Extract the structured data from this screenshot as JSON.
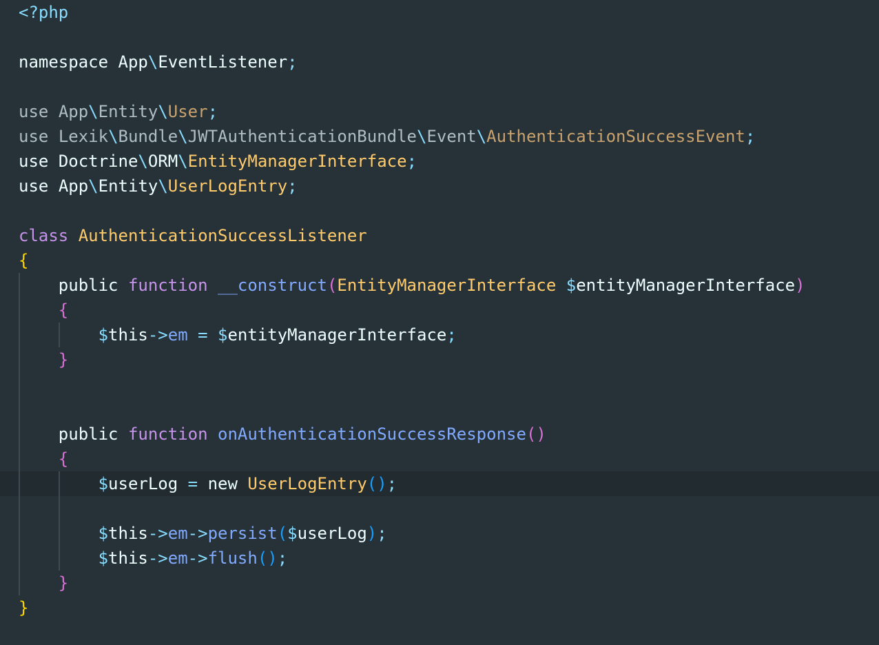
{
  "editor": {
    "language": "php",
    "theme_colors": {
      "background": "#263238",
      "current_line": "#222b30",
      "keyword": "#c792ea",
      "class_name": "#ffcb6b",
      "function": "#82aaff",
      "punctuation": "#89ddff",
      "brace_level_1": "#ffd700",
      "brace_level_2": "#da70d6",
      "brace_level_3": "#179fff"
    },
    "current_line_index": 19,
    "lines": [
      [
        {
          "t": "<?php",
          "c": "tag"
        }
      ],
      [],
      [
        {
          "t": "namespace",
          "c": "plain"
        },
        {
          "t": " ",
          "c": "plain"
        },
        {
          "t": "App",
          "c": "plain"
        },
        {
          "t": "\\",
          "c": "sep"
        },
        {
          "t": "EventListener",
          "c": "plain"
        },
        {
          "t": ";",
          "c": "punc"
        }
      ],
      [],
      [
        {
          "t": "use",
          "c": "ns"
        },
        {
          "t": " ",
          "c": "plain"
        },
        {
          "t": "App",
          "c": "ns"
        },
        {
          "t": "\\",
          "c": "sep"
        },
        {
          "t": "Entity",
          "c": "ns"
        },
        {
          "t": "\\",
          "c": "sep"
        },
        {
          "t": "User",
          "c": "clsd"
        },
        {
          "t": ";",
          "c": "punc"
        }
      ],
      [
        {
          "t": "use",
          "c": "ns"
        },
        {
          "t": " ",
          "c": "plain"
        },
        {
          "t": "Lexik",
          "c": "ns"
        },
        {
          "t": "\\",
          "c": "sep"
        },
        {
          "t": "Bundle",
          "c": "ns"
        },
        {
          "t": "\\",
          "c": "sep"
        },
        {
          "t": "JWTAuthenticationBundle",
          "c": "ns"
        },
        {
          "t": "\\",
          "c": "sep"
        },
        {
          "t": "Event",
          "c": "ns"
        },
        {
          "t": "\\",
          "c": "sep"
        },
        {
          "t": "AuthenticationSuccessEvent",
          "c": "clsd"
        },
        {
          "t": ";",
          "c": "punc"
        }
      ],
      [
        {
          "t": "use",
          "c": "plain"
        },
        {
          "t": " ",
          "c": "plain"
        },
        {
          "t": "Doctrine",
          "c": "plain"
        },
        {
          "t": "\\",
          "c": "sep"
        },
        {
          "t": "ORM",
          "c": "plain"
        },
        {
          "t": "\\",
          "c": "sep"
        },
        {
          "t": "EntityManagerInterface",
          "c": "cls"
        },
        {
          "t": ";",
          "c": "punc"
        }
      ],
      [
        {
          "t": "use",
          "c": "plain"
        },
        {
          "t": " ",
          "c": "plain"
        },
        {
          "t": "App",
          "c": "plain"
        },
        {
          "t": "\\",
          "c": "sep"
        },
        {
          "t": "Entity",
          "c": "plain"
        },
        {
          "t": "\\",
          "c": "sep"
        },
        {
          "t": "UserLogEntry",
          "c": "cls"
        },
        {
          "t": ";",
          "c": "punc"
        }
      ],
      [],
      [
        {
          "t": "class",
          "c": "kw"
        },
        {
          "t": " ",
          "c": "plain"
        },
        {
          "t": "AuthenticationSuccessListener",
          "c": "cls"
        }
      ],
      [
        {
          "t": "{",
          "c": "brace1"
        }
      ],
      [
        {
          "t": "    ",
          "c": "plain"
        },
        {
          "t": "public",
          "c": "plain"
        },
        {
          "t": " ",
          "c": "plain"
        },
        {
          "t": "function",
          "c": "kw"
        },
        {
          "t": " ",
          "c": "plain"
        },
        {
          "t": "__construct",
          "c": "fn"
        },
        {
          "t": "(",
          "c": "brace2"
        },
        {
          "t": "EntityManagerInterface",
          "c": "cls"
        },
        {
          "t": " ",
          "c": "plain"
        },
        {
          "t": "$",
          "c": "dollar"
        },
        {
          "t": "entityManagerInterface",
          "c": "var"
        },
        {
          "t": ")",
          "c": "brace2"
        }
      ],
      [
        {
          "t": "    ",
          "c": "plain"
        },
        {
          "t": "{",
          "c": "brace2"
        }
      ],
      [
        {
          "t": "        ",
          "c": "plain"
        },
        {
          "t": "$",
          "c": "dollar"
        },
        {
          "t": "this",
          "c": "var"
        },
        {
          "t": "->",
          "c": "op"
        },
        {
          "t": "em",
          "c": "prop"
        },
        {
          "t": " ",
          "c": "plain"
        },
        {
          "t": "=",
          "c": "op"
        },
        {
          "t": " ",
          "c": "plain"
        },
        {
          "t": "$",
          "c": "dollar"
        },
        {
          "t": "entityManagerInterface",
          "c": "var"
        },
        {
          "t": ";",
          "c": "punc"
        }
      ],
      [
        {
          "t": "    ",
          "c": "plain"
        },
        {
          "t": "}",
          "c": "brace2"
        }
      ],
      [],
      [],
      [
        {
          "t": "    ",
          "c": "plain"
        },
        {
          "t": "public",
          "c": "plain"
        },
        {
          "t": " ",
          "c": "plain"
        },
        {
          "t": "function",
          "c": "kw"
        },
        {
          "t": " ",
          "c": "plain"
        },
        {
          "t": "onAuthenticationSuccessResponse",
          "c": "fn"
        },
        {
          "t": "()",
          "c": "brace2"
        }
      ],
      [
        {
          "t": "    ",
          "c": "plain"
        },
        {
          "t": "{",
          "c": "brace2"
        }
      ],
      [
        {
          "t": "        ",
          "c": "plain"
        },
        {
          "t": "$",
          "c": "dollar"
        },
        {
          "t": "userLog",
          "c": "var"
        },
        {
          "t": " ",
          "c": "plain"
        },
        {
          "t": "=",
          "c": "op"
        },
        {
          "t": " ",
          "c": "plain"
        },
        {
          "t": "new",
          "c": "new"
        },
        {
          "t": " ",
          "c": "plain"
        },
        {
          "t": "UserLogEntry",
          "c": "cls"
        },
        {
          "t": "()",
          "c": "paren3"
        },
        {
          "t": ";",
          "c": "punc"
        }
      ],
      [],
      [
        {
          "t": "        ",
          "c": "plain"
        },
        {
          "t": "$",
          "c": "dollar"
        },
        {
          "t": "this",
          "c": "var"
        },
        {
          "t": "->",
          "c": "op"
        },
        {
          "t": "em",
          "c": "prop"
        },
        {
          "t": "->",
          "c": "op"
        },
        {
          "t": "persist",
          "c": "fn"
        },
        {
          "t": "(",
          "c": "paren3"
        },
        {
          "t": "$",
          "c": "dollar"
        },
        {
          "t": "userLog",
          "c": "var"
        },
        {
          "t": ")",
          "c": "paren3"
        },
        {
          "t": ";",
          "c": "punc"
        }
      ],
      [
        {
          "t": "        ",
          "c": "plain"
        },
        {
          "t": "$",
          "c": "dollar"
        },
        {
          "t": "this",
          "c": "var"
        },
        {
          "t": "->",
          "c": "op"
        },
        {
          "t": "em",
          "c": "prop"
        },
        {
          "t": "->",
          "c": "op"
        },
        {
          "t": "flush",
          "c": "fn"
        },
        {
          "t": "()",
          "c": "paren3"
        },
        {
          "t": ";",
          "c": "punc"
        }
      ],
      [
        {
          "t": "    ",
          "c": "plain"
        },
        {
          "t": "}",
          "c": "brace2"
        }
      ],
      [
        {
          "t": "}",
          "c": "brace1"
        }
      ]
    ]
  }
}
